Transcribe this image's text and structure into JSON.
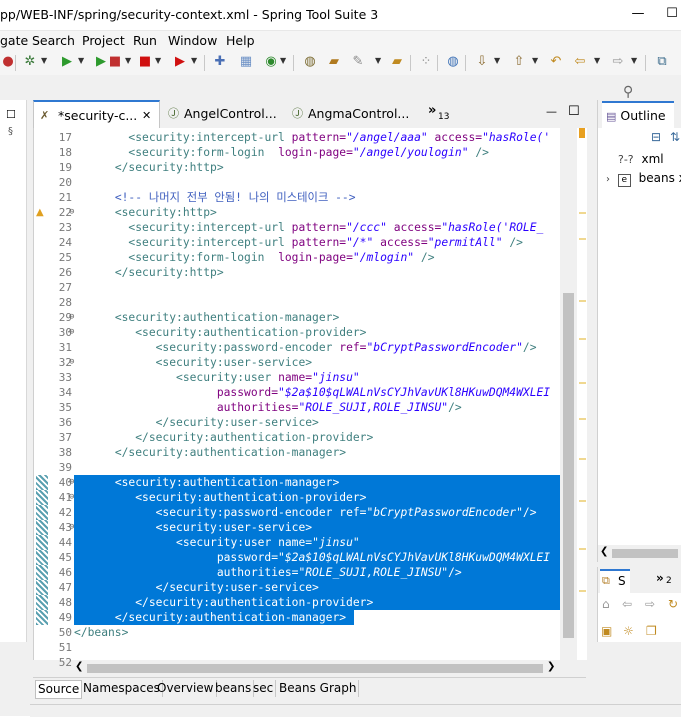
{
  "window": {
    "title": "pp/WEB-INF/spring/security-context.xml - Spring Tool Suite 3",
    "minimize": "—",
    "maximize": "☐"
  },
  "menu": [
    "gate",
    "Search",
    "Project",
    "Run",
    "Window",
    "Help"
  ],
  "editor_tabs": [
    {
      "label": "*security-c...",
      "icon": "xml-file-icon",
      "close": "✕"
    },
    {
      "label": "AngelControl...",
      "icon": "java-file-icon"
    },
    {
      "label": "AngmaControl...",
      "icon": "java-file-icon"
    }
  ],
  "overflow_tabs": {
    "chevron": "»",
    "count": "13"
  },
  "editor_view_buttons": {
    "minimize": "—",
    "maximize": "☐"
  },
  "code_lines": [
    {
      "n": "17",
      "fold": "",
      "sel": false,
      "segs": [
        {
          "c": "txt",
          "t": "        "
        },
        {
          "c": "tag",
          "t": "<security:intercept-url "
        },
        {
          "c": "attr",
          "t": "pattern="
        },
        {
          "c": "val",
          "t": "\"/angel/aaa\""
        },
        {
          "c": "attr",
          "t": " access="
        },
        {
          "c": "val",
          "t": "\"hasRole('"
        }
      ]
    },
    {
      "n": "18",
      "fold": "",
      "sel": false,
      "segs": [
        {
          "c": "txt",
          "t": "        "
        },
        {
          "c": "tag",
          "t": "<security:form-login  "
        },
        {
          "c": "attr",
          "t": "login-page="
        },
        {
          "c": "val",
          "t": "\"/angel/youlogin\""
        },
        {
          "c": "tag",
          "t": " />"
        }
      ]
    },
    {
      "n": "19",
      "fold": "",
      "sel": false,
      "segs": [
        {
          "c": "txt",
          "t": "      "
        },
        {
          "c": "tag",
          "t": "</security:http>"
        }
      ]
    },
    {
      "n": "20",
      "fold": "",
      "sel": false,
      "segs": []
    },
    {
      "n": "21",
      "fold": "",
      "sel": false,
      "segs": [
        {
          "c": "txt",
          "t": "      "
        },
        {
          "c": "cmt",
          "t": "<!-- 나머지 전부 안됨! 나의 미스테이크 -->"
        }
      ]
    },
    {
      "n": "22",
      "fold": "⊖",
      "sel": false,
      "warn": true,
      "segs": [
        {
          "c": "txt",
          "t": "      "
        },
        {
          "c": "tag",
          "t": "<security:http>"
        }
      ]
    },
    {
      "n": "23",
      "fold": "",
      "sel": false,
      "segs": [
        {
          "c": "txt",
          "t": "        "
        },
        {
          "c": "tag",
          "t": "<security:intercept-url "
        },
        {
          "c": "attr",
          "t": "pattern="
        },
        {
          "c": "val",
          "t": "\"/ccc\""
        },
        {
          "c": "attr",
          "t": " access="
        },
        {
          "c": "val",
          "t": "\"hasRole('ROLE_"
        }
      ]
    },
    {
      "n": "24",
      "fold": "",
      "sel": false,
      "segs": [
        {
          "c": "txt",
          "t": "        "
        },
        {
          "c": "tag",
          "t": "<security:intercept-url "
        },
        {
          "c": "attr",
          "t": "pattern="
        },
        {
          "c": "val",
          "t": "\"/*\""
        },
        {
          "c": "attr",
          "t": " access="
        },
        {
          "c": "val",
          "t": "\"permitAll\""
        },
        {
          "c": "tag",
          "t": " />"
        }
      ]
    },
    {
      "n": "25",
      "fold": "",
      "sel": false,
      "segs": [
        {
          "c": "txt",
          "t": "        "
        },
        {
          "c": "tag",
          "t": "<security:form-login  "
        },
        {
          "c": "attr",
          "t": "login-page="
        },
        {
          "c": "val",
          "t": "\"/mlogin\""
        },
        {
          "c": "tag",
          "t": " />"
        }
      ]
    },
    {
      "n": "26",
      "fold": "",
      "sel": false,
      "segs": [
        {
          "c": "txt",
          "t": "      "
        },
        {
          "c": "tag",
          "t": "</security:http>"
        }
      ]
    },
    {
      "n": "27",
      "fold": "",
      "sel": false,
      "segs": []
    },
    {
      "n": "28",
      "fold": "",
      "sel": false,
      "segs": []
    },
    {
      "n": "29",
      "fold": "⊖",
      "sel": false,
      "segs": [
        {
          "c": "txt",
          "t": "      "
        },
        {
          "c": "tag",
          "t": "<security:authentication-manager>"
        }
      ]
    },
    {
      "n": "30",
      "fold": "⊖",
      "sel": false,
      "segs": [
        {
          "c": "txt",
          "t": "         "
        },
        {
          "c": "tag",
          "t": "<security:authentication-provider>"
        }
      ]
    },
    {
      "n": "31",
      "fold": "",
      "sel": false,
      "segs": [
        {
          "c": "txt",
          "t": "            "
        },
        {
          "c": "tag",
          "t": "<security:password-encoder "
        },
        {
          "c": "attr",
          "t": "ref="
        },
        {
          "c": "val",
          "t": "\"bCryptPasswordEncoder\""
        },
        {
          "c": "tag",
          "t": "/>"
        }
      ]
    },
    {
      "n": "32",
      "fold": "⊖",
      "sel": false,
      "segs": [
        {
          "c": "txt",
          "t": "            "
        },
        {
          "c": "tag",
          "t": "<security:user-service>"
        }
      ]
    },
    {
      "n": "33",
      "fold": "",
      "sel": false,
      "segs": [
        {
          "c": "txt",
          "t": "               "
        },
        {
          "c": "tag",
          "t": "<security:user "
        },
        {
          "c": "attr",
          "t": "name="
        },
        {
          "c": "val",
          "t": "\"jinsu\""
        }
      ]
    },
    {
      "n": "34",
      "fold": "",
      "sel": false,
      "segs": [
        {
          "c": "txt",
          "t": "                     "
        },
        {
          "c": "attr",
          "t": "password="
        },
        {
          "c": "val",
          "t": "\"$2a$10$qLWALnVsCYJhVavUKl8HKuwDQM4WXLEI"
        }
      ]
    },
    {
      "n": "35",
      "fold": "",
      "sel": false,
      "segs": [
        {
          "c": "txt",
          "t": "                     "
        },
        {
          "c": "attr",
          "t": "authorities="
        },
        {
          "c": "val",
          "t": "\"ROLE_SUJI,ROLE_JINSU\""
        },
        {
          "c": "tag",
          "t": "/>"
        }
      ]
    },
    {
      "n": "36",
      "fold": "",
      "sel": false,
      "segs": [
        {
          "c": "txt",
          "t": "            "
        },
        {
          "c": "tag",
          "t": "</security:user-service>"
        }
      ]
    },
    {
      "n": "37",
      "fold": "",
      "sel": false,
      "segs": [
        {
          "c": "txt",
          "t": "         "
        },
        {
          "c": "tag",
          "t": "</security:authentication-provider>"
        }
      ]
    },
    {
      "n": "38",
      "fold": "",
      "sel": false,
      "segs": [
        {
          "c": "txt",
          "t": "      "
        },
        {
          "c": "tag",
          "t": "</security:authentication-manager>"
        }
      ]
    },
    {
      "n": "39",
      "fold": "",
      "sel": false,
      "segs": []
    },
    {
      "n": "40",
      "fold": "⊖",
      "sel": true,
      "segs": [
        {
          "c": "txt",
          "t": "      "
        },
        {
          "c": "tag",
          "t": "<security:authentication-manager>"
        }
      ]
    },
    {
      "n": "41",
      "fold": "⊖",
      "sel": true,
      "segs": [
        {
          "c": "txt",
          "t": "         "
        },
        {
          "c": "tag",
          "t": "<security:authentication-provider>"
        }
      ]
    },
    {
      "n": "42",
      "fold": "",
      "sel": true,
      "segs": [
        {
          "c": "txt",
          "t": "            "
        },
        {
          "c": "tag",
          "t": "<security:password-encoder "
        },
        {
          "c": "attr",
          "t": "ref="
        },
        {
          "c": "val",
          "t": "\"bCryptPasswordEncoder\""
        },
        {
          "c": "tag",
          "t": "/>"
        }
      ]
    },
    {
      "n": "43",
      "fold": "⊖",
      "sel": true,
      "segs": [
        {
          "c": "txt",
          "t": "            "
        },
        {
          "c": "tag",
          "t": "<security:user-service>"
        }
      ]
    },
    {
      "n": "44",
      "fold": "",
      "sel": true,
      "segs": [
        {
          "c": "txt",
          "t": "               "
        },
        {
          "c": "tag",
          "t": "<security:user "
        },
        {
          "c": "attr",
          "t": "name="
        },
        {
          "c": "val",
          "t": "\"jinsu\""
        }
      ]
    },
    {
      "n": "45",
      "fold": "",
      "sel": true,
      "segs": [
        {
          "c": "txt",
          "t": "                     "
        },
        {
          "c": "attr",
          "t": "password="
        },
        {
          "c": "val",
          "t": "\"$2a$10$qLWALnVsCYJhVavUKl8HKuwDQM4WXLEI"
        }
      ]
    },
    {
      "n": "46",
      "fold": "",
      "sel": true,
      "segs": [
        {
          "c": "txt",
          "t": "                     "
        },
        {
          "c": "attr",
          "t": "authorities="
        },
        {
          "c": "val",
          "t": "\"ROLE_SUJI,ROLE_JINSU\""
        },
        {
          "c": "tag",
          "t": "/>"
        }
      ]
    },
    {
      "n": "47",
      "fold": "",
      "sel": true,
      "segs": [
        {
          "c": "txt",
          "t": "            "
        },
        {
          "c": "tag",
          "t": "</security:user-service>"
        }
      ]
    },
    {
      "n": "48",
      "fold": "",
      "sel": true,
      "segs": [
        {
          "c": "txt",
          "t": "         "
        },
        {
          "c": "tag",
          "t": "</security:authentication-provider>"
        }
      ]
    },
    {
      "n": "49",
      "fold": "",
      "sel": true,
      "partial": true,
      "segs": [
        {
          "c": "txt",
          "t": "      "
        },
        {
          "c": "tag",
          "t": "</security:authentication-manager>"
        }
      ]
    },
    {
      "n": "50",
      "fold": "",
      "sel": false,
      "segs": [
        {
          "c": "tag",
          "t": "</beans>"
        }
      ]
    },
    {
      "n": "51",
      "fold": "",
      "sel": false,
      "segs": []
    },
    {
      "n": "52",
      "fold": "",
      "sel": false,
      "segs": []
    }
  ],
  "bottom_tabs": [
    "Source",
    "Namespaces",
    "Overview",
    "beans",
    "sec",
    "Beans Graph"
  ],
  "outline": {
    "title": "Outline",
    "items": [
      {
        "prefix": "?-?",
        "label": "xml"
      },
      {
        "prefix": "e",
        "label": "beans xm"
      }
    ]
  },
  "second_panel": {
    "tab": "S",
    "overflow": "2"
  },
  "colors": {
    "selection": "#0078d7",
    "tag": "#3f7f7f",
    "attr": "#7f007f",
    "value": "#2a00ff",
    "comment": "#3f5fbf",
    "active_tab_border": "#2f78d1"
  }
}
